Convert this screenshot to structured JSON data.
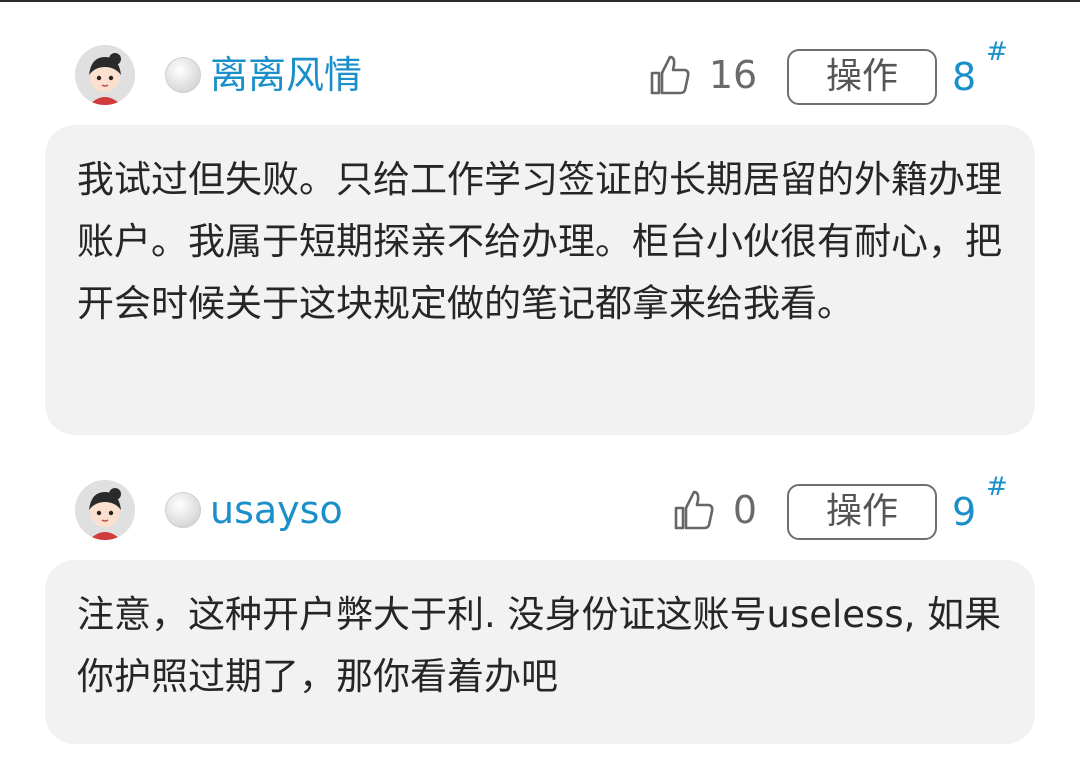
{
  "posts": [
    {
      "username": "离离风情",
      "likes": "16",
      "action_label": "操作",
      "floor": "8",
      "floor_mark": "#",
      "content": "我试过但失败。只给工作学习签证的长期居留的外籍办理账户。我属于短期探亲不给办理。柜台小伙很有耐心，把开会时候关于这块规定做的笔记都拿来给我看。"
    },
    {
      "username": "usayso",
      "likes": "0",
      "action_label": "操作",
      "floor": "9",
      "floor_mark": "#",
      "content": "注意，这种开户弊大于利. 没身份证这账号useless, 如果你护照过期了，那你看着办吧"
    }
  ],
  "icons": {
    "avatar": "cartoon-avatar-icon",
    "status": "offline-status-dot-icon",
    "like": "thumbs-up-icon"
  },
  "colors": {
    "username": "#1a8fc9",
    "floor": "#1a8fc9",
    "bubble_bg": "#f2f2f2",
    "text": "#262626"
  }
}
